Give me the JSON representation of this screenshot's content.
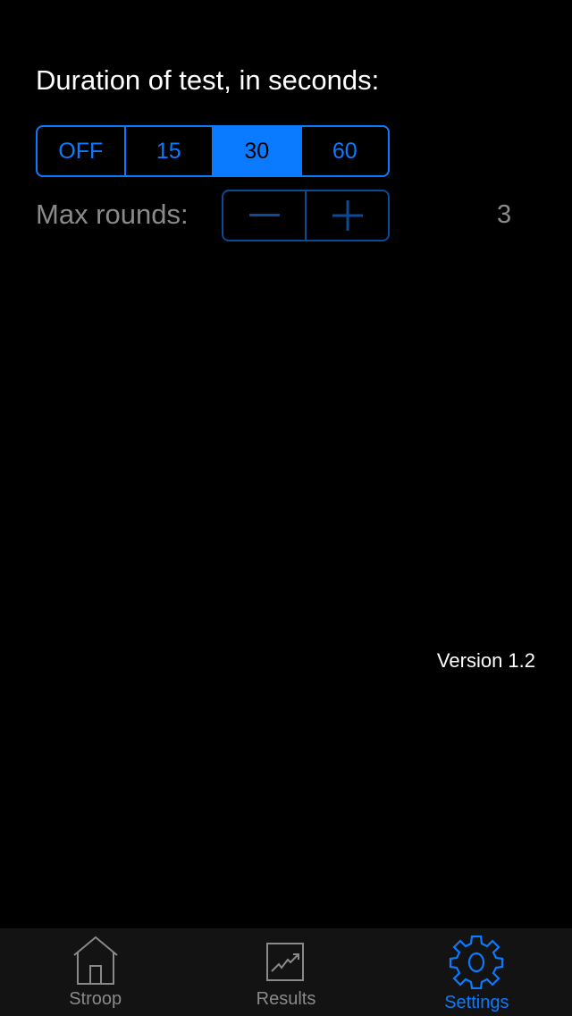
{
  "settings": {
    "duration_label": "Duration of test, in seconds:",
    "duration_options": [
      "OFF",
      "15",
      "30",
      "60"
    ],
    "selected_duration": "30",
    "max_rounds_label": "Max rounds:",
    "max_rounds_value": "3"
  },
  "version": "Version 1.2",
  "tabs": [
    {
      "label": "Stroop",
      "icon": "house-icon"
    },
    {
      "label": "Results",
      "icon": "chart-icon"
    },
    {
      "label": "Settings",
      "icon": "gear-icon",
      "active": true
    }
  ],
  "colors": {
    "accent": "#0a7aff",
    "inactive": "#8a8a8a"
  }
}
